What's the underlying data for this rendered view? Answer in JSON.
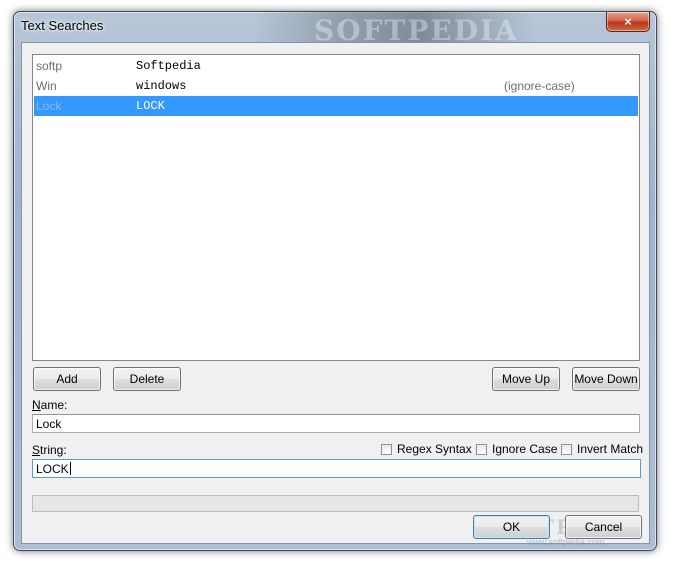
{
  "window": {
    "title": "Text Searches",
    "close_glyph": "×",
    "watermark": "SOFTPEDIA",
    "watermark_url": "www.softpedia.com"
  },
  "list": {
    "rows": [
      {
        "name": "softp",
        "string": "Softpedia",
        "flags": "",
        "selected": false
      },
      {
        "name": "Win",
        "string": "windows",
        "flags": "(ignore-case)",
        "selected": false
      },
      {
        "name": "Lock",
        "string": "LOCK",
        "flags": "",
        "selected": true
      }
    ]
  },
  "buttons": {
    "add": "Add",
    "delete": "Delete",
    "move_up": "Move Up",
    "move_down": "Move Down",
    "ok": "OK",
    "cancel": "Cancel"
  },
  "name_field": {
    "label_access": "N",
    "label_rest": "ame:",
    "value": "Lock"
  },
  "string_field": {
    "label_access": "S",
    "label_rest": "tring:",
    "value": "LOCK"
  },
  "options": {
    "regex": {
      "label": "Regex Syntax",
      "checked": false
    },
    "ignore_case": {
      "label": "Ignore Case",
      "checked": false
    },
    "invert_match": {
      "label": "Invert Match",
      "checked": false
    }
  },
  "colors": {
    "selection": "#3399ff",
    "close_button": "#c7462a"
  }
}
